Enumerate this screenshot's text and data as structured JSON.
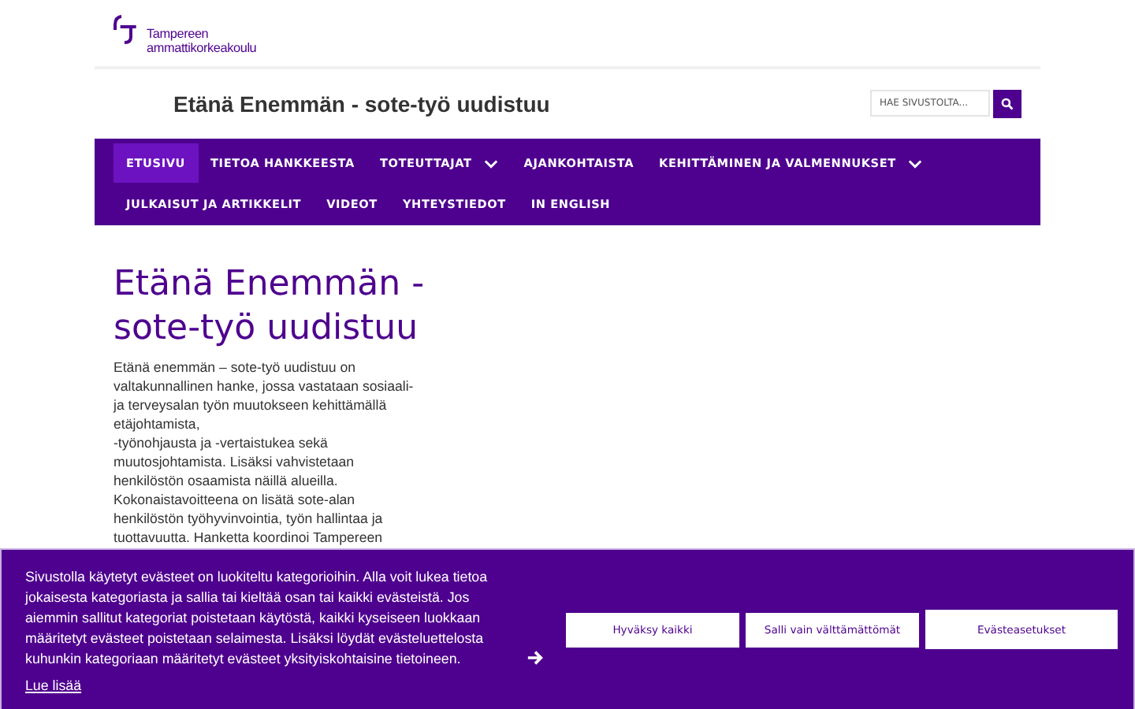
{
  "logo": {
    "lines": [
      "Tampereen",
      "ammattikorkeakoulu"
    ]
  },
  "site_title": "Etänä Enemmän - sote-työ uudistuu",
  "search": {
    "placeholder": "HAE SIVUSTOLTA..."
  },
  "nav": [
    {
      "label": "ETUSIVU",
      "selected": true,
      "has_submenu": false
    },
    {
      "label": "TIETOA HANKKEESTA",
      "selected": false,
      "has_submenu": false
    },
    {
      "label": "TOTEUTTAJAT",
      "selected": false,
      "has_submenu": true
    },
    {
      "label": "AJANKOHTAISTA",
      "selected": false,
      "has_submenu": false
    },
    {
      "label": "KEHITTÄMINEN JA VALMENNUKSET",
      "selected": false,
      "has_submenu": true
    },
    {
      "label": "JULKAISUT JA ARTIKKELIT",
      "selected": false,
      "has_submenu": false
    },
    {
      "label": "VIDEOT",
      "selected": false,
      "has_submenu": false
    },
    {
      "label": "YHTEYSTIEDOT",
      "selected": false,
      "has_submenu": false
    },
    {
      "label": "IN ENGLISH",
      "selected": false,
      "has_submenu": false
    }
  ],
  "heading": "Etänä Enemmän - sote-työ uudistuu",
  "paragraph": [
    "Etänä enemmän – sote-työ uudistuu on valtakunnallinen hanke, jossa vastataan sosiaali- ja terveysalan työn muutokseen kehittämällä etäjohtamista,",
    "-työnohjausta ja -vertaistukea sekä muutosjohtamista. Lisäksi vahvistetaan henkilöstön osaamista näillä alueilla. Kokonaistavoitteena on lisätä sote-alan henkilöstön työhyvinvointia, työn hallintaa ja tuottavuutta. Hanketta koordinoi Tampereen"
  ],
  "cookie_banner": {
    "text": "Sivustolla käytetyt evästeet on luokiteltu kategorioihin. Alla voit lukea tietoa jokaisesta kategoriasta ja sallia tai kieltää osan tai kaikki evästeistä. Jos aiemmin sallitut kategoriat poistetaan käytöstä, kaikki kyseiseen luokkaan määritetyt evästeet poistetaan selaimesta. Lisäksi löydät evästeluettelosta kuhunkin kategoriaan määritetyt evästeet yksityiskohtaisine tietoineen.",
    "link": "Lue lisää",
    "buttons": [
      "Hyväksy kaikki",
      "Salli vain välttämättömät",
      "Evästeasetukset"
    ]
  }
}
